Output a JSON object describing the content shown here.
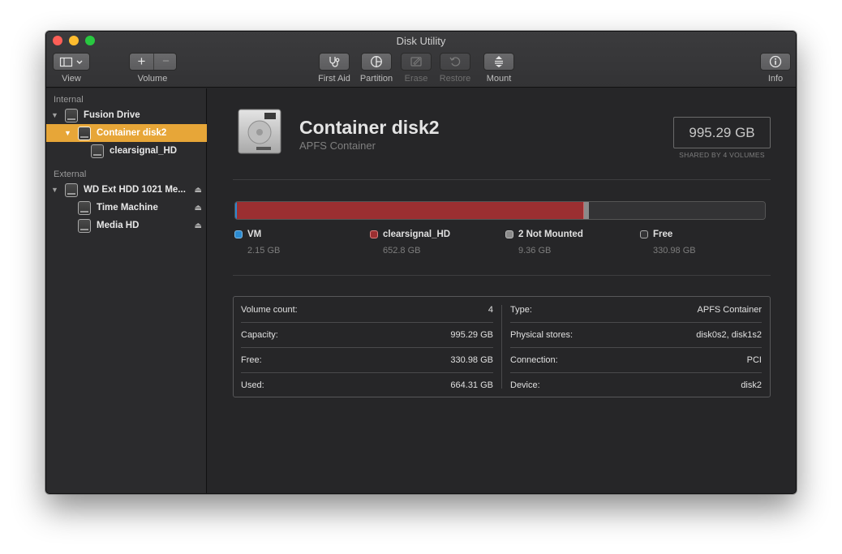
{
  "window": {
    "title": "Disk Utility"
  },
  "toolbar": {
    "view_label": "View",
    "volume_label": "Volume",
    "first_aid_label": "First Aid",
    "partition_label": "Partition",
    "erase_label": "Erase",
    "restore_label": "Restore",
    "mount_label": "Mount",
    "info_label": "Info",
    "add_glyph": "+",
    "remove_glyph": "−"
  },
  "sidebar": {
    "internal_header": "Internal",
    "external_header": "External",
    "items": [
      {
        "label": "Fusion Drive",
        "icon": "hard-disk-icon"
      },
      {
        "label": "Container disk2",
        "icon": "container-icon",
        "selected": true
      },
      {
        "label": "clearsignal_HD",
        "icon": "volume-icon"
      },
      {
        "label": "WD Ext HDD 1021 Me...",
        "icon": "external-disk-icon"
      },
      {
        "label": "Time Machine",
        "icon": "volume-icon"
      },
      {
        "label": "Media HD",
        "icon": "volume-icon"
      }
    ]
  },
  "main": {
    "title": "Container disk2",
    "subtitle": "APFS Container",
    "size": "995.29 GB",
    "size_note": "SHARED BY 4 VOLUMES",
    "usage": [
      {
        "name": "VM",
        "size": "2.15 GB",
        "gb": 2.15,
        "color": "#2b8ad0"
      },
      {
        "name": "clearsignal_HD",
        "size": "652.8 GB",
        "gb": 652.8,
        "color": "#9b2f31"
      },
      {
        "name": "2 Not Mounted",
        "size": "9.36 GB",
        "gb": 9.36,
        "color": "#8a8a8a"
      },
      {
        "name": "Free",
        "size": "330.98 GB",
        "gb": 330.98,
        "color": "#333335"
      }
    ],
    "info_left": [
      {
        "key": "Volume count:",
        "value": "4"
      },
      {
        "key": "Capacity:",
        "value": "995.29 GB"
      },
      {
        "key": "Free:",
        "value": "330.98 GB"
      },
      {
        "key": "Used:",
        "value": "664.31 GB"
      }
    ],
    "info_right": [
      {
        "key": "Type:",
        "value": "APFS Container"
      },
      {
        "key": "Physical stores:",
        "value": "disk0s2, disk1s2"
      },
      {
        "key": "Connection:",
        "value": "PCI"
      },
      {
        "key": "Device:",
        "value": "disk2"
      }
    ]
  },
  "colors": {
    "accent": "#e7a638",
    "window_bg": "#262628"
  }
}
